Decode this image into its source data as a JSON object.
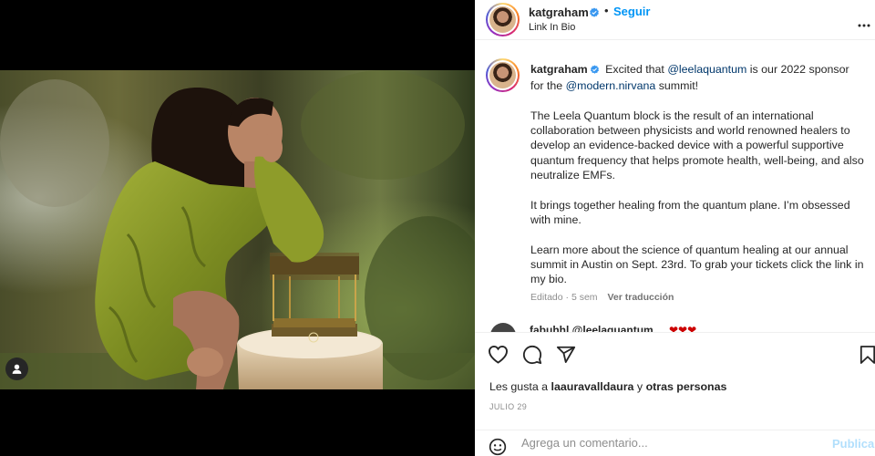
{
  "post": {
    "username": "katgraham",
    "follow_label": "Seguir",
    "dot": "•",
    "subtitle": "Link In Bio"
  },
  "caption": {
    "username": "katgraham",
    "intro_1": "Excited that",
    "mention_1": "@leelaquantum",
    "intro_2": "is our 2022 sponsor for the",
    "mention_2": "@modern.nirvana",
    "intro_3": "summit!",
    "paragraph_2": "The Leela Quantum block is the result of an international collaboration between physicists and world renowned healers to develop an evidence-backed device with a powerful supportive quantum frequency that helps promote health, well-being, and also neutralize EMFs.",
    "paragraph_3": "It brings together healing from the quantum plane. I’m obsessed with mine.",
    "paragraph_4": "Learn more about the science of quantum healing at our annual summit in Austin on Sept. 23rd. To grab your tickets click the link in my bio.",
    "edited_meta": "Editado · 5 sem",
    "translate_label": "Ver traducción"
  },
  "next_comment": {
    "text": "fabuhhl  @leelaquantum",
    "emojis": "❤❤❤"
  },
  "actions": {
    "icons": [
      "heart-outline-icon",
      "comment-icon",
      "share-icon",
      "bookmark-icon"
    ]
  },
  "likes": {
    "prefix": "Les gusta a",
    "user": "laauravalldaura",
    "middle": "y",
    "others": "otras personas"
  },
  "date": "JULIO 29",
  "comment_box": {
    "placeholder": "Agrega un comentario...",
    "publish_label": "Publicar"
  },
  "colors": {
    "accent_blue": "#0095f6",
    "publish_disabled": "#b2dffc",
    "mention": "#00376b",
    "verified": "#3897f0"
  }
}
